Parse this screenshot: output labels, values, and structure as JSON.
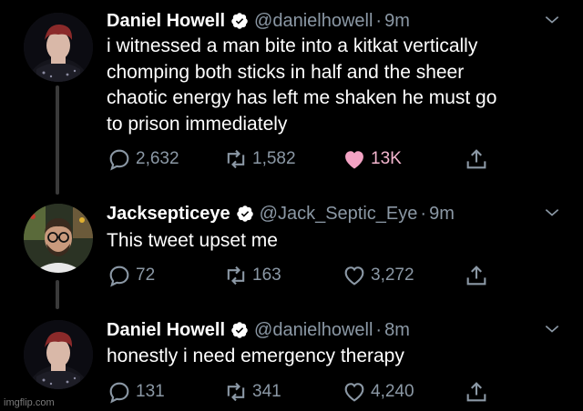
{
  "colors": {
    "background": "#000000",
    "text": "#ffffff",
    "muted": "#8b98a5",
    "verified": "#ffffff",
    "liked": "#f4a3c4",
    "thread_line": "#3a3a3a"
  },
  "tweets": [
    {
      "name": "Daniel Howell",
      "handle": "@danielhowell",
      "separator": "·",
      "time": "9m",
      "lines": [
        "i witnessed a man bite into a kitkat vertically",
        "chomping both sticks in half and the sheer",
        "chaotic energy has left me shaken he must go",
        "to prison immediately"
      ],
      "replies": "2,632",
      "retweets": "1,582",
      "likes": "13K",
      "liked": true,
      "avatar_icon": "user-avatar-photo"
    },
    {
      "name": "Jacksepticeye",
      "handle": "@Jack_Septic_Eye",
      "separator": "·",
      "time": "9m",
      "lines": [
        "This tweet upset me"
      ],
      "replies": "72",
      "retweets": "163",
      "likes": "3,272",
      "liked": false,
      "avatar_icon": "user-avatar-photo"
    },
    {
      "name": "Daniel Howell",
      "handle": "@danielhowell",
      "separator": "·",
      "time": "8m",
      "lines": [
        "honestly i need emergency therapy"
      ],
      "replies": "131",
      "retweets": "341",
      "likes": "4,240",
      "liked": false,
      "avatar_icon": "user-avatar-photo"
    }
  ],
  "watermark": "imgflip.com"
}
